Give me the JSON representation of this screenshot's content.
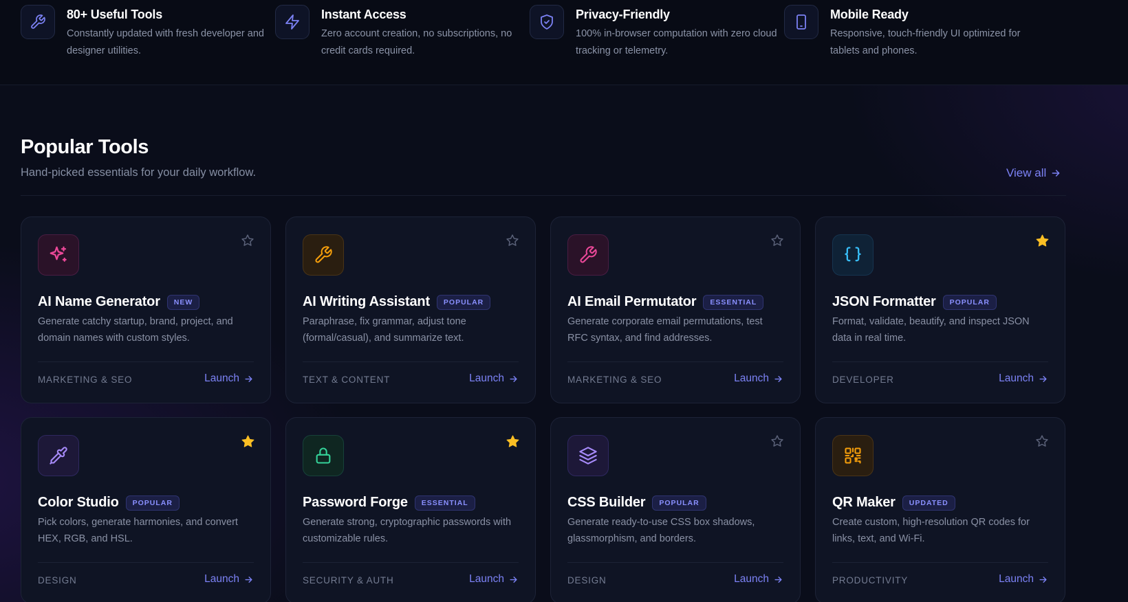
{
  "features": [
    {
      "title": "80+ Useful Tools",
      "desc": "Constantly updated with fresh developer and designer utilities.",
      "icon": "wrench-icon"
    },
    {
      "title": "Instant Access",
      "desc": "Zero account creation, no subscriptions, no credit cards required.",
      "icon": "lightning-icon"
    },
    {
      "title": "Privacy-Friendly",
      "desc": "100% in-browser computation with zero cloud tracking or telemetry.",
      "icon": "shield-check-icon"
    },
    {
      "title": "Mobile Ready",
      "desc": "Responsive, touch-friendly UI optimized for tablets and phones.",
      "icon": "phone-icon"
    }
  ],
  "section": {
    "title": "Popular Tools",
    "subtitle": "Hand-picked essentials for your daily workflow.",
    "view_all": "View all"
  },
  "cards": [
    {
      "title": "AI Name Generator",
      "badge": "NEW",
      "desc": "Generate catchy startup, brand, project, and domain names with custom styles.",
      "category": "MARKETING & SEO",
      "launch": "Launch",
      "icon": "sparkles-icon",
      "accent": "#ec4899",
      "favorited": false
    },
    {
      "title": "AI Writing Assistant",
      "badge": "POPULAR",
      "desc": "Paraphrase, fix grammar, adjust tone (formal/casual), and summarize text.",
      "category": "TEXT & CONTENT",
      "launch": "Launch",
      "icon": "wrench-icon",
      "accent": "#f59e0b",
      "favorited": false
    },
    {
      "title": "AI Email Permutator",
      "badge": "ESSENTIAL",
      "desc": "Generate corporate email permutations, test RFC syntax, and find addresses.",
      "category": "MARKETING & SEO",
      "launch": "Launch",
      "icon": "wrench-icon",
      "accent": "#ec4899",
      "favorited": false
    },
    {
      "title": "JSON Formatter",
      "badge": "POPULAR",
      "desc": "Format, validate, beautify, and inspect JSON data in real time.",
      "category": "DEVELOPER",
      "launch": "Launch",
      "icon": "braces-icon",
      "accent": "#38bdf8",
      "favorited": true
    },
    {
      "title": "Color Studio",
      "badge": "POPULAR",
      "desc": "Pick colors, generate harmonies, and convert HEX, RGB, and HSL.",
      "category": "DESIGN",
      "launch": "Launch",
      "icon": "eyedropper-icon",
      "accent": "#a78bfa",
      "favorited": true
    },
    {
      "title": "Password Forge",
      "badge": "ESSENTIAL",
      "desc": "Generate strong, cryptographic passwords with customizable rules.",
      "category": "SECURITY & AUTH",
      "launch": "Launch",
      "icon": "lock-icon",
      "accent": "#34d399",
      "favorited": true
    },
    {
      "title": "CSS Builder",
      "badge": "POPULAR",
      "desc": "Generate ready-to-use CSS box shadows, glassmorphism, and borders.",
      "category": "DESIGN",
      "launch": "Launch",
      "icon": "layers-icon",
      "accent": "#a78bfa",
      "favorited": false
    },
    {
      "title": "QR Maker",
      "badge": "UPDATED",
      "desc": "Create custom, high-resolution QR codes for links, text, and Wi-Fi.",
      "category": "PRODUCTIVITY",
      "launch": "Launch",
      "icon": "qr-code-icon",
      "accent": "#f59e0b",
      "favorited": false
    }
  ],
  "colors": {
    "accent_link": "#7c82f5",
    "star_filled": "#fbbf24",
    "star_empty": "#5a6178"
  }
}
